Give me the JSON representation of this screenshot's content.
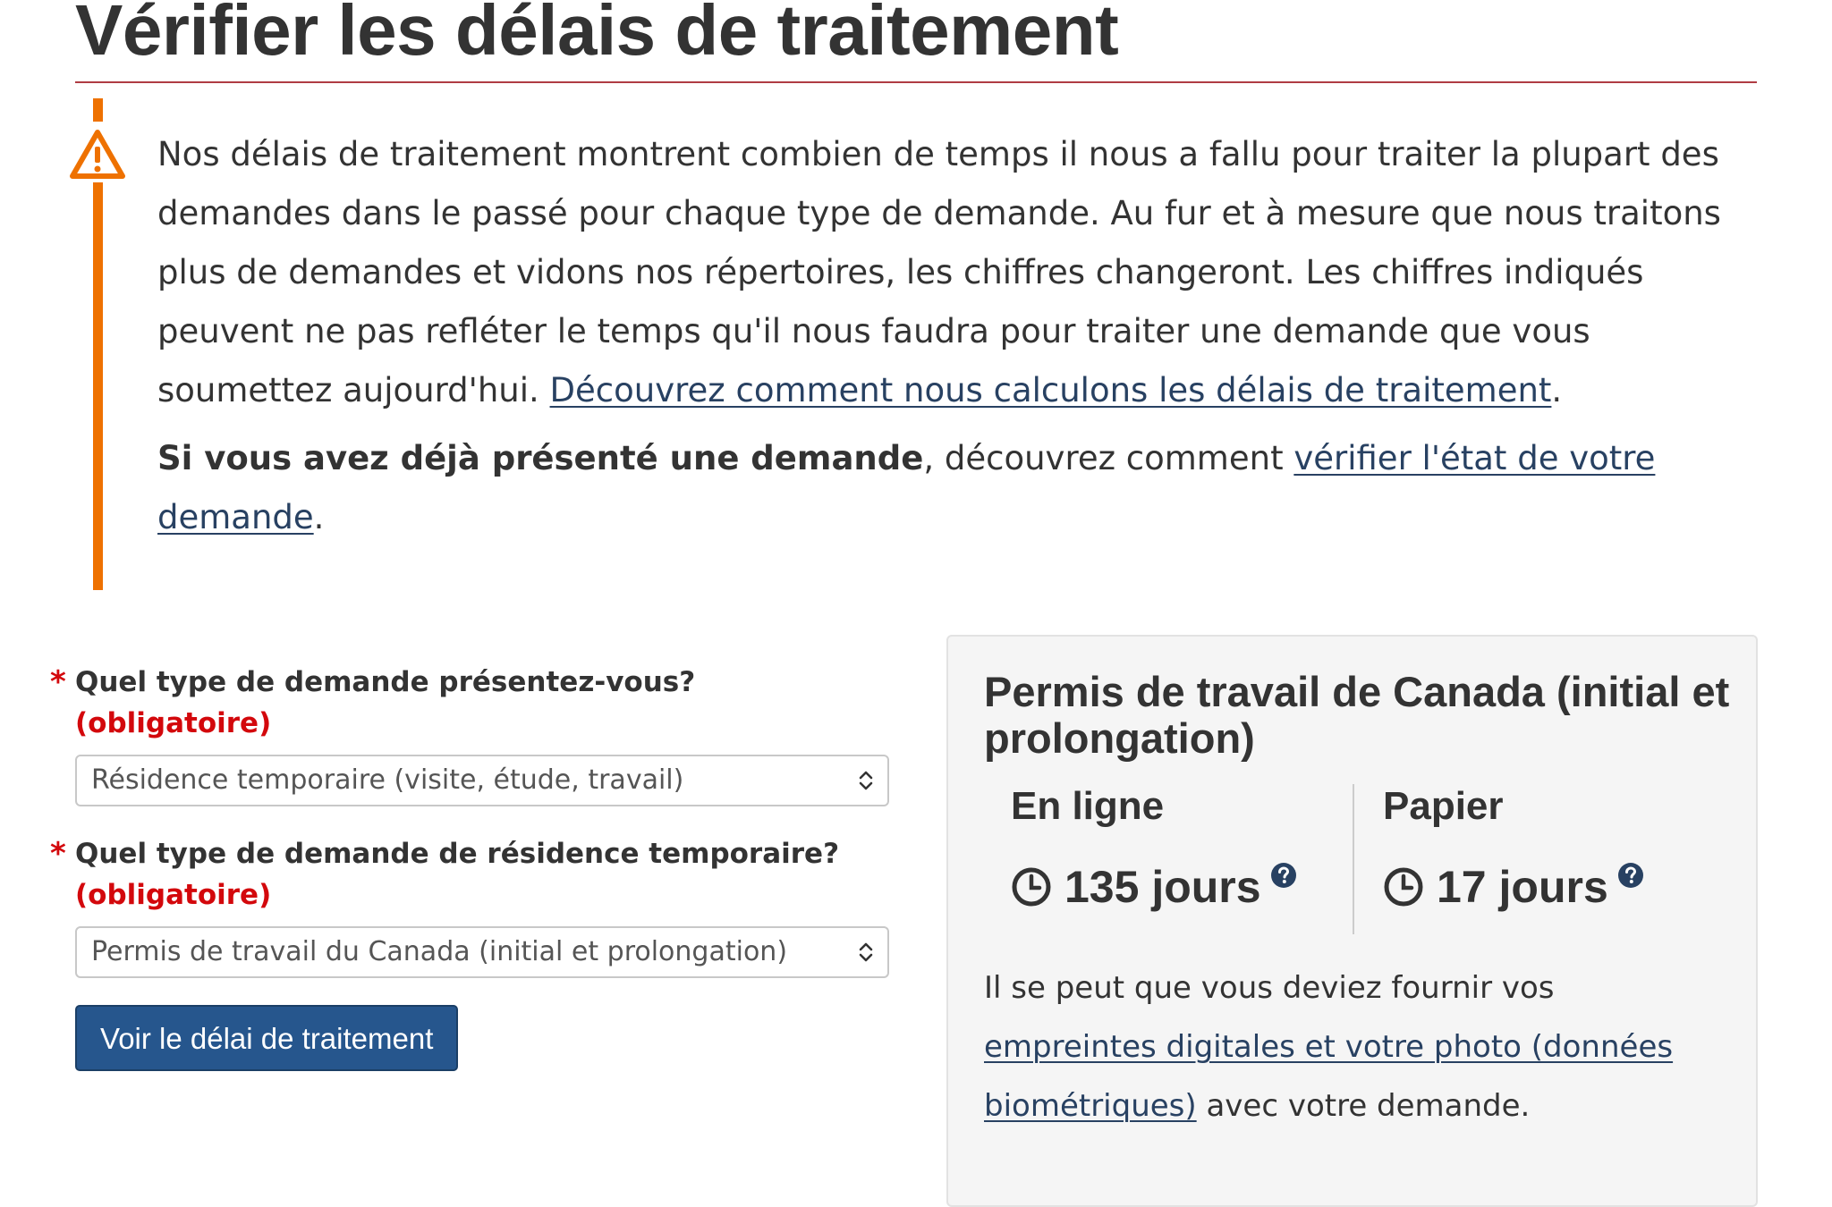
{
  "page": {
    "title": "Vérifier les délais de traitement"
  },
  "warning": {
    "icon": "warning-triangle-icon",
    "accent_color": "#ee7100",
    "paragraph1_text": "Nos délais de traitement montrent combien de temps il nous a fallu pour traiter la plupart des demandes dans le passé pour chaque type de demande. Au fur et à mesure que nous traitons plus de demandes et vidons nos répertoires, les chiffres changeront. Les chiffres indiqués peuvent ne pas refléter le temps qu'il nous faudra pour traiter une demande que vous soumettez aujourd'hui. ",
    "paragraph1_link": "Découvrez comment nous calculons les délais de traitement",
    "paragraph1_end": ".",
    "paragraph2_bold": "Si vous avez déjà présenté une demande",
    "paragraph2_text": ", découvrez comment ",
    "paragraph2_link": "vérifier l'état de votre demande",
    "paragraph2_end": "."
  },
  "form": {
    "field1": {
      "asterisk": "*",
      "label": "Quel type de demande présentez-vous?",
      "required": "(obligatoire)",
      "value": "Résidence temporaire (visite, étude, travail)"
    },
    "field2": {
      "asterisk": "*",
      "label": "Quel type de demande de résidence temporaire?",
      "required": "(obligatoire)",
      "value": "Permis de travail du Canada (initial et prolongation)"
    },
    "submit_label": "Voir le délai de traitement"
  },
  "result": {
    "title": "Permis de travail de Canada (initial et prolongation)",
    "online_label": "En ligne",
    "online_time": "135 jours",
    "paper_label": "Papier",
    "paper_time": "17 jours",
    "note_text": "Il se peut que vous deviez fournir vos ",
    "note_link": "empreintes digitales et votre photo (données biométriques)",
    "note_end": " avec votre demande."
  },
  "colors": {
    "title_rule": "#af3c43",
    "link": "#284162",
    "required": "#d3080c",
    "button": "#26568d"
  }
}
